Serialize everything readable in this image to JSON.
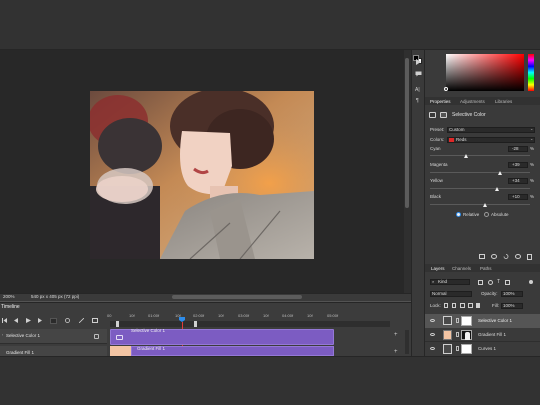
{
  "colors": {
    "accent": "#2d8ceb",
    "clip": "#7c5cc2",
    "playhead": "#e03b3b",
    "reds_swatch": "#e12828",
    "foreground": "#000000",
    "background": "#ffffff"
  },
  "status": {
    "zoom": "200%",
    "doc_info": "540 px x 405 px (72 ppi)"
  },
  "timeline": {
    "title": "Timeline",
    "ruler": [
      "00",
      "10f",
      "01:00f",
      "10f",
      "02:00f",
      "10f",
      "03:00f",
      "10f",
      "04:00f",
      "10f",
      "05:00f"
    ],
    "tracks": [
      {
        "name": "Selective Color 1",
        "clip_label": "Selective Color 1"
      },
      {
        "name": "Gradient Fill 1",
        "clip_label": "Gradient Fill 1"
      }
    ]
  },
  "tool_icons": [
    "play-icon",
    "comment-icon",
    "character-icon",
    "paragraph-icon"
  ],
  "properties": {
    "tabs": [
      "Properties",
      "Adjustments",
      "Libraries"
    ],
    "title": "Selective Color",
    "preset_label": "Preset:",
    "preset_value": "Custom",
    "colors_label": "Colors:",
    "colors_value": "Reds",
    "sliders": [
      {
        "name": "Cyan",
        "value": "-28",
        "unit": "%",
        "level": 0.36
      },
      {
        "name": "Magenta",
        "value": "+39",
        "unit": "%",
        "level": 0.7
      },
      {
        "name": "Yellow",
        "value": "+34",
        "unit": "%",
        "level": 0.67
      },
      {
        "name": "Black",
        "value": "+10",
        "unit": "%",
        "level": 0.55
      }
    ],
    "method_relative": "Relative",
    "method_absolute": "Absolute"
  },
  "layers": {
    "tabs": [
      "Layers",
      "Channels",
      "Paths"
    ],
    "filter": "Kind",
    "blend_mode": "Normal",
    "opacity_label": "Opacity:",
    "opacity_value": "100%",
    "lock_label": "Lock:",
    "fill_label": "Fill:",
    "fill_value": "100%",
    "items": [
      {
        "name": "Selective Color 1"
      },
      {
        "name": "Gradient Fill 1"
      },
      {
        "name": "Curves 1"
      }
    ]
  }
}
